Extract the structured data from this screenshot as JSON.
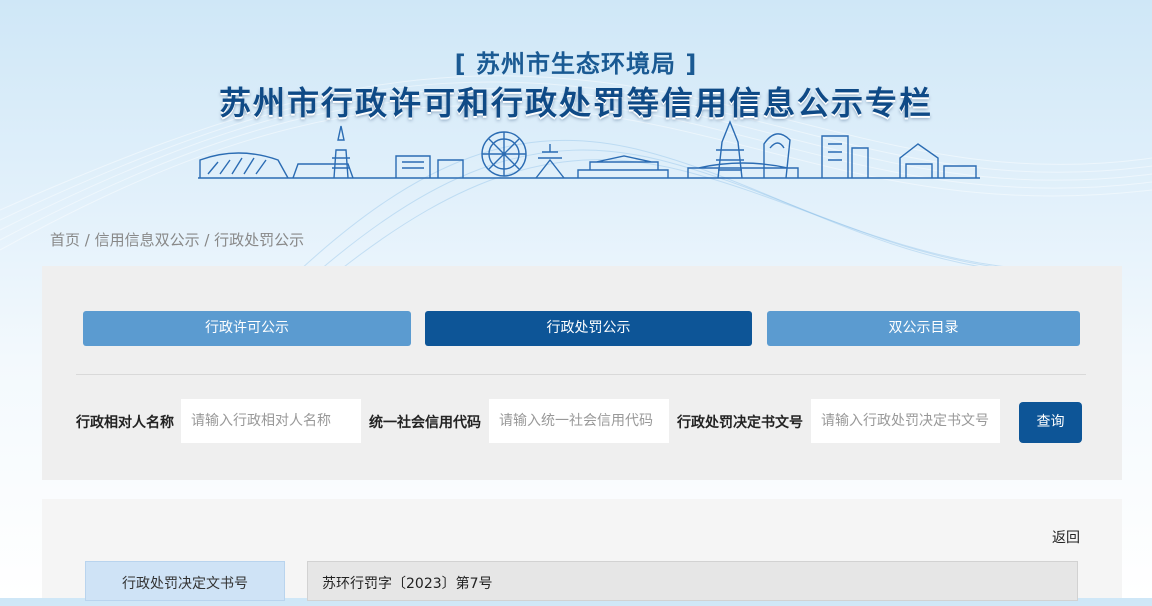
{
  "header": {
    "department": "[ 苏州市生态环境局 ]",
    "title": "苏州市行政许可和行政处罚等信用信息公示专栏"
  },
  "breadcrumb": "首页 / 信用信息双公示 / 行政处罚公示",
  "tabs": [
    {
      "label": "行政许可公示",
      "active": false
    },
    {
      "label": "行政处罚公示",
      "active": true
    },
    {
      "label": "双公示目录",
      "active": false
    }
  ],
  "search": {
    "subject_label": "行政相对人名称",
    "subject_placeholder": "请输入行政相对人名称",
    "credit_label": "统一社会信用代码",
    "credit_placeholder": "请输入统一社会信用代码",
    "doc_label": "行政处罚决定书文号",
    "doc_placeholder": "请输入行政处罚决定书文号",
    "button": "查询"
  },
  "detail": {
    "back": "返回",
    "rows": [
      {
        "label": "行政处罚决定文书号",
        "value": "苏环行罚字〔2023〕第7号"
      }
    ]
  },
  "colors": {
    "tab_active": "#0d5597",
    "tab_inactive": "#5b9bd0",
    "title": "#0f4a86"
  }
}
